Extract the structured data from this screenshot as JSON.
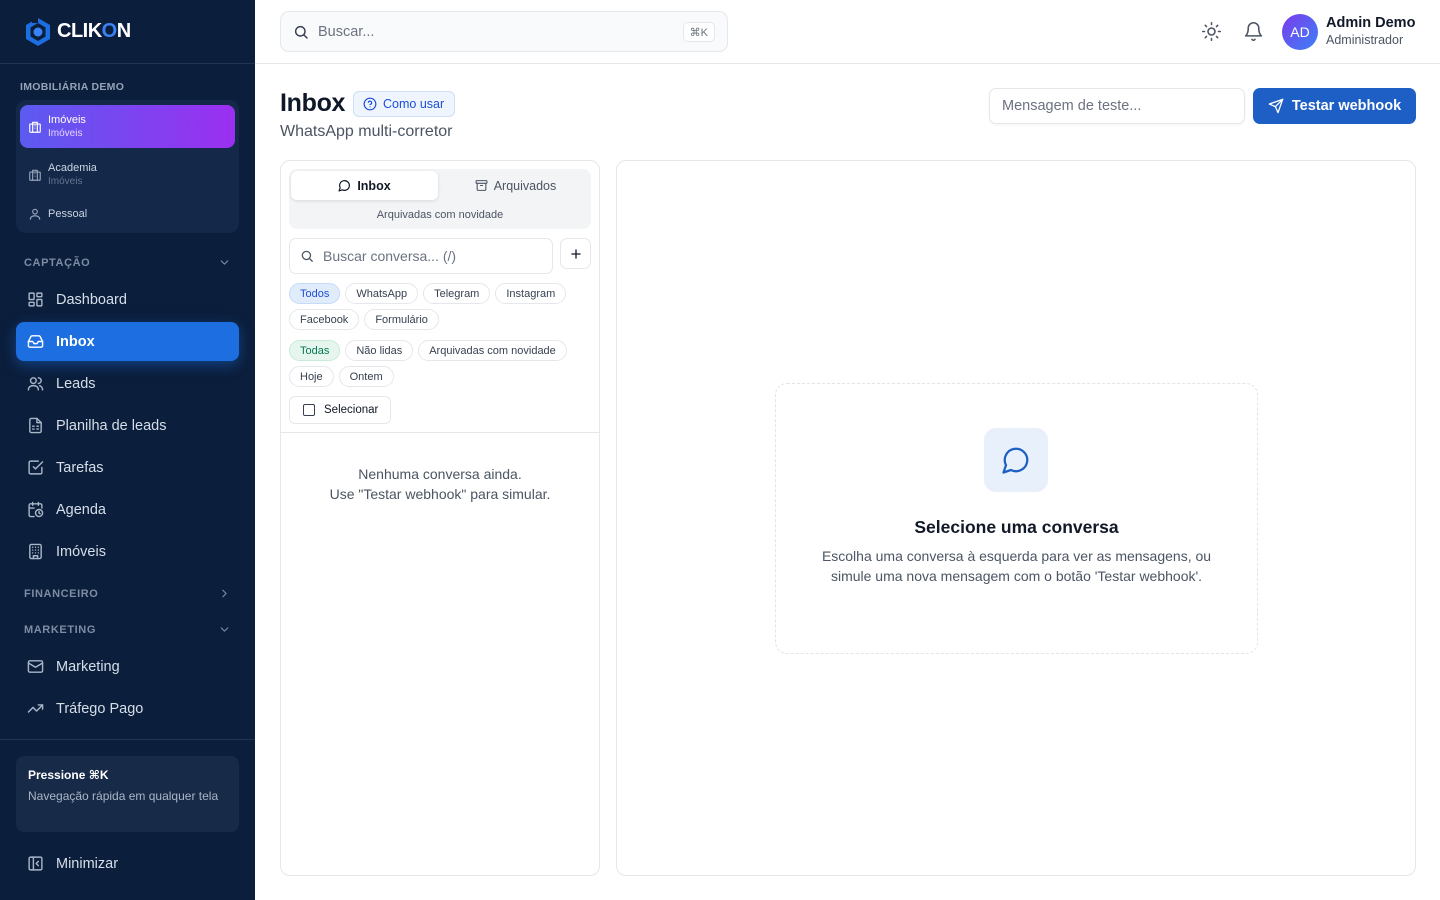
{
  "brand": {
    "logo_text_a": "CLIK",
    "logo_text_b": "O",
    "logo_text_c": "N",
    "accent": "#3b82f6"
  },
  "sidebar": {
    "workspace_title": "IMOBILIÁRIA DEMO",
    "workspaces": [
      {
        "name": "Imóveis",
        "sub": "Imóveis",
        "icon": "building-icon",
        "active": true
      },
      {
        "name": "Academia",
        "sub": "Imóveis",
        "icon": "building-icon",
        "active": false
      },
      {
        "name": "Pessoal",
        "sub": "",
        "icon": "user-icon",
        "active": false
      }
    ],
    "sections": {
      "captacao": "CAPTAÇÃO",
      "financeiro": "FINANCEIRO",
      "marketing": "MARKETING"
    },
    "nav": {
      "dashboard": "Dashboard",
      "inbox": "Inbox",
      "leads": "Leads",
      "planilha": "Planilha de leads",
      "tarefas": "Tarefas",
      "agenda": "Agenda",
      "imoveis": "Imóveis",
      "marketing": "Marketing",
      "trafego": "Tráfego Pago"
    },
    "tip": {
      "title": "Pressione ⌘K",
      "body": "Navegação rápida em qualquer tela"
    },
    "minimize": "Minimizar"
  },
  "topbar": {
    "search_placeholder": "Buscar...",
    "search_kbd": "⌘K",
    "user_initials": "AD",
    "user_name": "Admin Demo",
    "user_role": "Administrador"
  },
  "page": {
    "title": "Inbox",
    "howto": "Como usar",
    "subtitle": "WhatsApp multi-corretor",
    "test_input_placeholder": "Mensagem de teste...",
    "test_button": "Testar webhook"
  },
  "left_panel": {
    "tabs": {
      "inbox": "Inbox",
      "archived": "Arquivados"
    },
    "archived_note": "Arquivadas com novidade",
    "search_placeholder": "Buscar conversa... (/)",
    "channel_filters": [
      "Todos",
      "WhatsApp",
      "Telegram",
      "Instagram",
      "Facebook",
      "Formulário"
    ],
    "status_filters": [
      "Todas",
      "Não lidas",
      "Arquivadas com novidade",
      "Hoje",
      "Ontem"
    ],
    "select_label": "Selecionar",
    "empty_line1": "Nenhuma conversa ainda.",
    "empty_line2": "Use \"Testar webhook\" para simular."
  },
  "right_panel": {
    "empty_title": "Selecione uma conversa",
    "empty_desc": "Escolha uma conversa à esquerda para ver as mensagens, ou simule uma nova mensagem com o botão 'Testar webhook'."
  }
}
